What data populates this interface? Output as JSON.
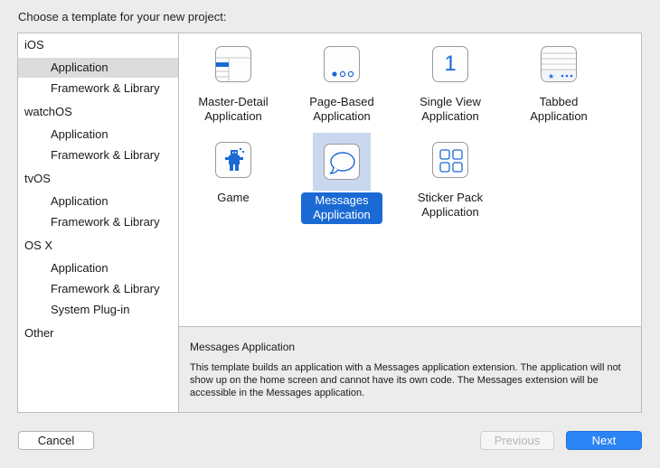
{
  "header": {
    "title": "Choose a template for your new project:"
  },
  "sidebar": {
    "groups": [
      {
        "label": "iOS",
        "items": [
          {
            "label": "Application"
          },
          {
            "label": "Framework & Library"
          }
        ]
      },
      {
        "label": "watchOS",
        "items": [
          {
            "label": "Application"
          },
          {
            "label": "Framework & Library"
          }
        ]
      },
      {
        "label": "tvOS",
        "items": [
          {
            "label": "Application"
          },
          {
            "label": "Framework & Library"
          }
        ]
      },
      {
        "label": "OS X",
        "items": [
          {
            "label": "Application"
          },
          {
            "label": "Framework & Library"
          },
          {
            "label": "System Plug-in"
          }
        ]
      },
      {
        "label": "Other",
        "items": []
      }
    ],
    "selected": "iOS / Application"
  },
  "templates": [
    {
      "label_line1": "Master-Detail",
      "label_line2": "Application",
      "icon": "master-detail-icon"
    },
    {
      "label_line1": "Page-Based",
      "label_line2": "Application",
      "icon": "page-based-icon"
    },
    {
      "label_line1": "Single View",
      "label_line2": "Application",
      "icon": "single-view-icon",
      "icon_glyph": "1"
    },
    {
      "label_line1": "Tabbed",
      "label_line2": "Application",
      "icon": "tabbed-icon"
    },
    {
      "label_line1": "Game",
      "label_line2": "",
      "icon": "game-icon"
    },
    {
      "label_line1": "Messages",
      "label_line2": "Application",
      "icon": "messages-icon",
      "selected": true
    },
    {
      "label_line1": "Sticker Pack",
      "label_line2": "Application",
      "icon": "sticker-pack-icon"
    }
  ],
  "description": {
    "title": "Messages Application",
    "body": "This template builds an application with a Messages application extension. The application will not show up on the home screen and cannot have its own code. The Messages extension will be accessible in the Messages application."
  },
  "buttons": {
    "cancel": "Cancel",
    "previous": "Previous",
    "next": "Next"
  },
  "colors": {
    "accent": "#1b6ad4",
    "primary_button": "#2b84f4",
    "selection_bg": "#c9d8ef",
    "sidebar_selection": "#dcdcdc"
  }
}
